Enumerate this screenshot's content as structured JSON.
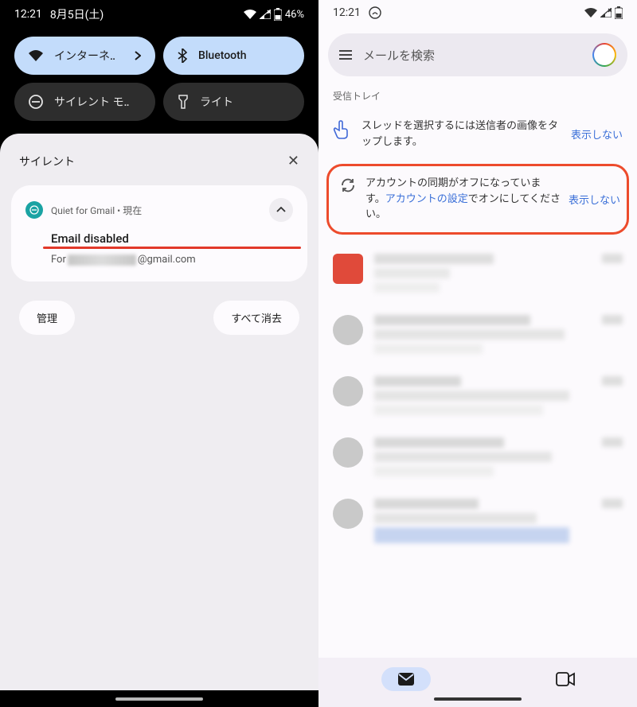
{
  "left": {
    "status": {
      "time": "12:21",
      "date": "8月5日(土)",
      "battery": "46%"
    },
    "tiles": {
      "internet": "インターネ‥",
      "bluetooth": "Bluetooth",
      "silent": "サイレント モ‥",
      "light": "ライト"
    },
    "silent_section": "サイレント",
    "notification": {
      "app": "Quiet for Gmail",
      "time_sep": " • ",
      "when": "現在",
      "title": "Email disabled",
      "body_prefix": "For ",
      "body_suffix": "@gmail.com"
    },
    "actions": {
      "manage": "管理",
      "clear_all": "すべて消去"
    }
  },
  "right": {
    "status": {
      "time": "12:21"
    },
    "search_placeholder": "メールを検索",
    "inbox_label": "受信トレイ",
    "tip1": {
      "text": "スレッドを選択するには送信者の画像をタップします。",
      "dismiss": "表示しない"
    },
    "tip2": {
      "pre": "アカウントの同期がオフになっています。",
      "link": "アカウントの設定",
      "post": "でオンにしてください。",
      "dismiss": "表示しない"
    }
  }
}
